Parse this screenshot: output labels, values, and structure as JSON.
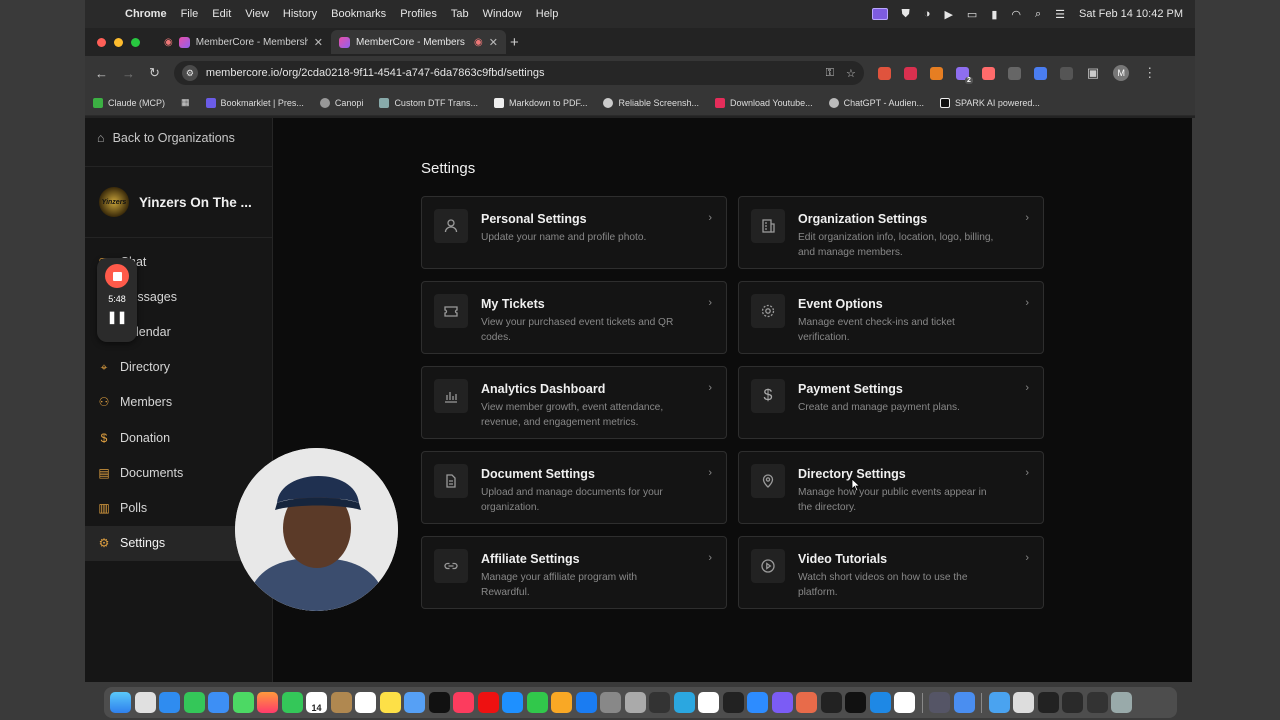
{
  "menubar": {
    "app_name": "Chrome",
    "items": [
      "File",
      "Edit",
      "View",
      "History",
      "Bookmarks",
      "Profiles",
      "Tab",
      "Window",
      "Help"
    ],
    "clock": "Sat Feb 14  10:42 PM"
  },
  "browser": {
    "tabs": [
      {
        "title": "MemberCore - Membership &",
        "active": false
      },
      {
        "title": "MemberCore - Members",
        "active": true
      }
    ],
    "url": "membercore.io/org/2cda0218-9f11-4541-a747-6da7863c9fbd/settings",
    "profile_initial": "M",
    "extension_badge": "2",
    "bookmarks": [
      "Claude (MCP)",
      "Bookmarklet | Pres...",
      "Canopi",
      "Custom DTF Trans...",
      "Markdown to PDF...",
      "Reliable Screensh...",
      "Download Youtube...",
      "ChatGPT - Audien...",
      "SPARK AI powered..."
    ]
  },
  "sidebar": {
    "back_label": "Back to Organizations",
    "org_name": "Yinzers On The ...",
    "org_logo_text": "Yinzers",
    "items": [
      {
        "label": "Chat",
        "icon": "chat-icon"
      },
      {
        "label": "Messages",
        "icon": "messages-icon"
      },
      {
        "label": "Calendar",
        "icon": "calendar-icon"
      },
      {
        "label": "Directory",
        "icon": "map-pin-icon"
      },
      {
        "label": "Members",
        "icon": "users-icon"
      },
      {
        "label": "Donation",
        "icon": "dollar-icon"
      },
      {
        "label": "Documents",
        "icon": "document-icon"
      },
      {
        "label": "Polls",
        "icon": "bar-chart-icon"
      },
      {
        "label": "Settings",
        "icon": "gear-icon",
        "active": true
      }
    ]
  },
  "recorder": {
    "time": "5:48"
  },
  "settings": {
    "title": "Settings",
    "cards": [
      {
        "title": "Personal Settings",
        "desc": "Update your name and profile photo.",
        "icon": "user-icon"
      },
      {
        "title": "Organization Settings",
        "desc": "Edit organization info, location, logo, billing, and manage members.",
        "icon": "building-icon"
      },
      {
        "title": "My Tickets",
        "desc": "View your purchased event tickets and QR codes.",
        "icon": "ticket-icon"
      },
      {
        "title": "Event Options",
        "desc": "Manage event check-ins and ticket verification.",
        "icon": "gear-icon"
      },
      {
        "title": "Analytics Dashboard",
        "desc": "View member growth, event attendance, revenue, and engagement metrics.",
        "icon": "bar-chart-icon"
      },
      {
        "title": "Payment Settings",
        "desc": "Create and manage payment plans.",
        "icon": "dollar-icon"
      },
      {
        "title": "Document Settings",
        "desc": "Upload and manage documents for your organization.",
        "icon": "document-icon"
      },
      {
        "title": "Directory Settings",
        "desc": "Manage how your public events appear in the directory.",
        "icon": "map-pin-icon"
      },
      {
        "title": "Affiliate Settings",
        "desc": "Manage your affiliate program with Rewardful.",
        "icon": "link-icon"
      },
      {
        "title": "Video Tutorials",
        "desc": "Watch short videos on how to use the platform.",
        "icon": "play-icon"
      }
    ]
  },
  "dock": {
    "calendar_day": "14"
  }
}
